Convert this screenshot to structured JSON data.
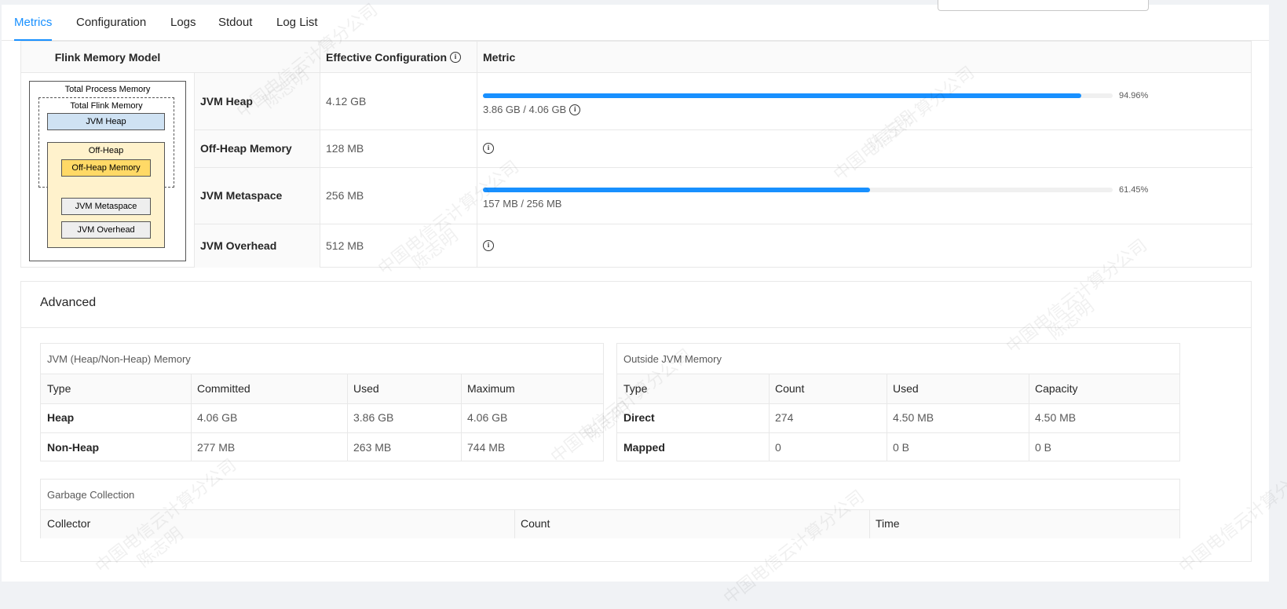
{
  "tabs": [
    "Metrics",
    "Configuration",
    "Logs",
    "Stdout",
    "Log List"
  ],
  "memory_model": {
    "headers": {
      "model": "Flink Memory Model",
      "config": "Effective Configuration",
      "metric": "Metric"
    },
    "diagram": {
      "total_process": "Total Process Memory",
      "total_flink": "Total Flink Memory",
      "jvm_heap": "JVM Heap",
      "off_heap": "Off-Heap",
      "off_heap_memory": "Off-Heap Memory",
      "jvm_metaspace": "JVM Metaspace",
      "jvm_overhead": "JVM Overhead"
    },
    "rows": [
      {
        "label": "JVM Heap",
        "config": "4.12 GB",
        "usage": "3.86 GB / 4.06 GB",
        "percent": "94.96%",
        "fraction": 0.9496
      },
      {
        "label": "Off-Heap Memory",
        "config": "128 MB"
      },
      {
        "label": "JVM Metaspace",
        "config": "256 MB",
        "usage": "157 MB / 256 MB",
        "percent": "61.45%",
        "fraction": 0.6145
      },
      {
        "label": "JVM Overhead",
        "config": "512 MB"
      }
    ]
  },
  "advanced": {
    "title": "Advanced",
    "jvm_memory": {
      "title": "JVM (Heap/Non-Heap) Memory",
      "columns": [
        "Type",
        "Committed",
        "Used",
        "Maximum"
      ],
      "rows": [
        [
          "Heap",
          "4.06 GB",
          "3.86 GB",
          "4.06 GB"
        ],
        [
          "Non-Heap",
          "277 MB",
          "263 MB",
          "744 MB"
        ]
      ]
    },
    "outside_memory": {
      "title": "Outside JVM Memory",
      "columns": [
        "Type",
        "Count",
        "Used",
        "Capacity"
      ],
      "rows": [
        [
          "Direct",
          "274",
          "4.50 MB",
          "4.50 MB"
        ],
        [
          "Mapped",
          "0",
          "0 B",
          "0 B"
        ]
      ]
    },
    "gc": {
      "title": "Garbage Collection",
      "columns": [
        "Collector",
        "Count",
        "Time"
      ]
    }
  },
  "watermark": {
    "line1": "中国电信云计算分公司",
    "line2": "陈志明"
  },
  "colors": {
    "accent": "#1890ff",
    "heap_box": "#cfe2f3",
    "offheap_box": "#fff2cc",
    "offheap_memory_box": "#ffd966"
  }
}
